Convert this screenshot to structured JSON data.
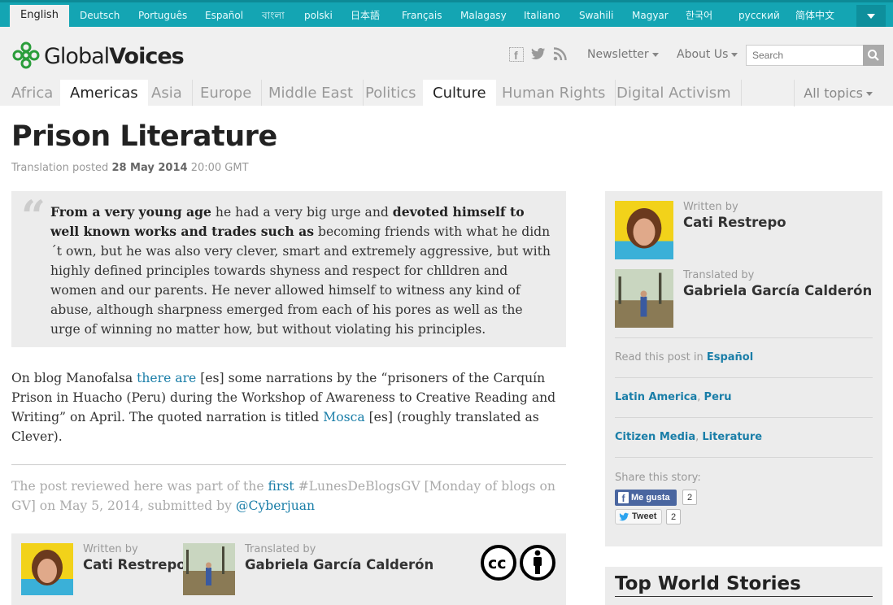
{
  "languages": [
    {
      "label": "English",
      "active": true
    },
    {
      "label": "Deutsch"
    },
    {
      "label": "Português"
    },
    {
      "label": "Español"
    },
    {
      "label": "বাংলা"
    },
    {
      "label": "polski"
    },
    {
      "label": "日本語"
    },
    {
      "label": "Français"
    },
    {
      "label": "Malagasy"
    },
    {
      "label": "Italiano"
    },
    {
      "label": "Swahili"
    },
    {
      "label": "Magyar"
    },
    {
      "label": "한국어"
    },
    {
      "label": "русский"
    },
    {
      "label": "简体中文"
    }
  ],
  "header": {
    "logo_light": "Global",
    "logo_bold": "Voices",
    "newsletter": "Newsletter",
    "about": "About Us",
    "search_placeholder": "Search"
  },
  "topics": [
    "Africa",
    "Americas",
    "Asia",
    "Europe",
    "Middle East",
    "Politics",
    "Culture",
    "Human Rights",
    "Digital Activism"
  ],
  "active_topics": [
    "Americas",
    "Culture"
  ],
  "all_topics": "All topics",
  "article": {
    "title": "Prison Literature",
    "meta_prefix": "Translation posted",
    "date": "28 May 2014",
    "time": "20:00 GMT",
    "quote": {
      "b1": "From a very young age",
      "t1": " he had a very big urge and ",
      "b2": "devoted himself to well known works and trades such as",
      "t2": " becoming friends with what he didn´t own, but he was also very clever, smart and extremely aggressive, but with highly defined principles towards shyness and respect for chlldren and women and our parents. He never allowed himself to witness any kind of abuse, although sharpness emerged from each of his pores as well as the urge of winning no matter how, but without violating his principles."
    },
    "para": {
      "t1": "On blog Manofalsa ",
      "link1": "there are",
      "t2": " [es] some narrations by the “prisoners of the Carquín Prison in Huacho (Peru) during the Workshop of Awareness to Creative Reading and Writing” on April. The quoted narration is titled ",
      "link2": "Mosca",
      "t3": " [es] (roughly translated as Clever)."
    },
    "note": {
      "t1": "The post reviewed here was part of the ",
      "link1": "first",
      "t2": " #LunesDeBlogsGV [Monday of blogs on GV] on May 5, 2014, submitted by ",
      "link2": "@Cyberjuan"
    }
  },
  "credits": {
    "written_by_label": "Written by",
    "author": "Cati Restrepo",
    "translated_by_label": "Translated by",
    "translator": "Gabriela García Calderón"
  },
  "sidebar": {
    "read_in_prefix": "Read this post in",
    "read_in_lang": "Español",
    "regions": [
      "Latin America",
      "Peru"
    ],
    "categories": [
      "Citizen Media",
      "Literature"
    ],
    "share_label": "Share this story:",
    "fb_label": "Me gusta",
    "fb_count": "2",
    "tw_label": "Tweet",
    "tw_count": "2"
  },
  "top_stories_title": "Top World Stories",
  "colors": {
    "teal_bar": "#14a5b3",
    "link": "#1a7ea8",
    "logo_green": "#2a9d3a"
  }
}
